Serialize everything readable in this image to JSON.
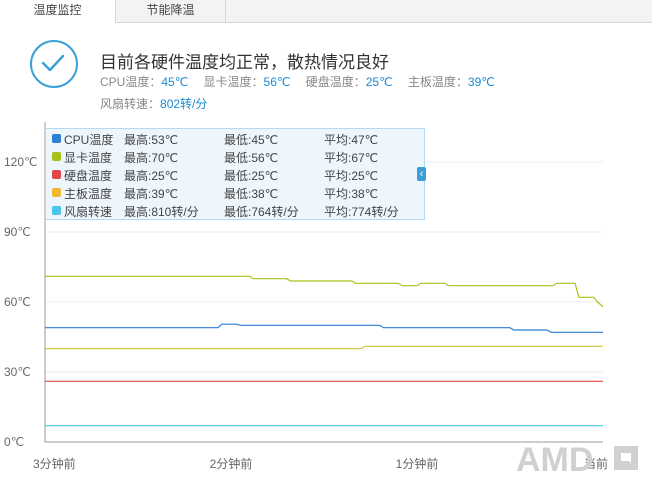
{
  "tabs": [
    {
      "label": "温度监控",
      "active": true
    },
    {
      "label": "节能降温",
      "active": false
    }
  ],
  "status": {
    "headline": "目前各硬件温度均正常，散热情况良好",
    "metrics": [
      {
        "label": "CPU温度：",
        "value": "45℃"
      },
      {
        "label": "显卡温度：",
        "value": "56℃"
      },
      {
        "label": "硬盘温度：",
        "value": "25℃"
      },
      {
        "label": "主板温度：",
        "value": "39℃"
      }
    ],
    "fan": {
      "label": "风扇转速：",
      "value": "802转/分"
    }
  },
  "legend": [
    {
      "name": "CPU温度",
      "max": "最高:53℃",
      "min": "最低:45℃",
      "avg": "平均:47℃",
      "color": "#2b7fd4"
    },
    {
      "name": "显卡温度",
      "max": "最高:70℃",
      "min": "最低:56℃",
      "avg": "平均:67℃",
      "color": "#a8c21a"
    },
    {
      "name": "硬盘温度",
      "max": "最高:25℃",
      "min": "最低:25℃",
      "avg": "平均:25℃",
      "color": "#e04848"
    },
    {
      "name": "主板温度",
      "max": "最高:39℃",
      "min": "最低:38℃",
      "avg": "平均:38℃",
      "color": "#f2b830"
    },
    {
      "name": "风扇转速",
      "max": "最高:810转/分",
      "min": "最低:764转/分",
      "avg": "平均:774转/分",
      "color": "#48c6ea"
    }
  ],
  "legend_toggle_icon": "chevron-left-icon",
  "chart_data": {
    "type": "line",
    "ylim": [
      0,
      120
    ],
    "y_ticks": [
      "0℃",
      "30℃",
      "60℃",
      "90℃",
      "120℃"
    ],
    "y_tick_values": [
      0,
      30,
      60,
      90,
      120
    ],
    "x_range_minutes": [
      -3,
      0
    ],
    "x_ticks": [
      "3分钟前",
      "2分钟前",
      "1分钟前",
      "当前"
    ],
    "x_tick_values": [
      -3,
      -2,
      -1,
      0
    ],
    "grid": true,
    "series": [
      {
        "name": "CPU温度",
        "color": "#2b7fd4",
        "points": [
          [
            -3,
            49
          ],
          [
            -2.07,
            49
          ],
          [
            -2.05,
            50.5
          ],
          [
            -1.97,
            50.5
          ],
          [
            -1.95,
            50
          ],
          [
            -1.2,
            50
          ],
          [
            -1.18,
            49
          ],
          [
            -0.5,
            49
          ],
          [
            -0.48,
            48
          ],
          [
            -0.3,
            48
          ],
          [
            -0.28,
            47
          ],
          [
            0,
            47
          ]
        ]
      },
      {
        "name": "显卡温度",
        "color": "#a8c21a",
        "points": [
          [
            -3,
            71
          ],
          [
            -1.9,
            71
          ],
          [
            -1.88,
            70
          ],
          [
            -1.7,
            70
          ],
          [
            -1.68,
            69
          ],
          [
            -1.35,
            69
          ],
          [
            -1.33,
            68
          ],
          [
            -1.1,
            68
          ],
          [
            -1.08,
            67
          ],
          [
            -1.0,
            67
          ],
          [
            -0.98,
            68
          ],
          [
            -0.85,
            68
          ],
          [
            -0.83,
            67
          ],
          [
            -0.27,
            67
          ],
          [
            -0.25,
            68
          ],
          [
            -0.15,
            68
          ],
          [
            -0.13,
            62
          ],
          [
            -0.05,
            62
          ],
          [
            -0.03,
            60
          ],
          [
            0,
            58
          ]
        ]
      },
      {
        "name": "硬盘温度",
        "color": "#e04848",
        "points": [
          [
            -3,
            26
          ],
          [
            0,
            26
          ]
        ]
      },
      {
        "name": "主板温度",
        "color": "#c9c83a",
        "points": [
          [
            -3,
            40
          ],
          [
            -1.3,
            40
          ],
          [
            -1.28,
            41
          ],
          [
            0,
            41
          ]
        ]
      },
      {
        "name": "风扇转速",
        "color": "#48c6ea",
        "points": [
          [
            -3,
            7
          ],
          [
            0,
            7
          ]
        ]
      }
    ]
  },
  "brand": "AMD"
}
